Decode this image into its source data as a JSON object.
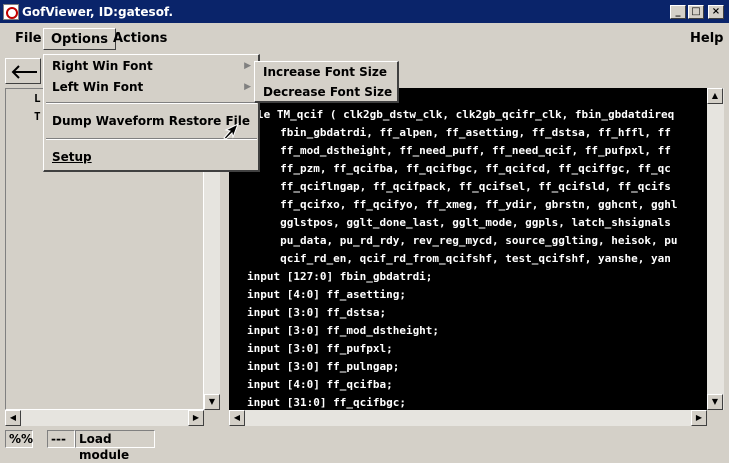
{
  "window": {
    "title": "GofViewer, ID:gatesof."
  },
  "menubar": {
    "file": "File",
    "options": "Options",
    "actions": "Actions",
    "help": "Help"
  },
  "options_menu": {
    "items": [
      {
        "label": "Right Win Font",
        "has_submenu": true
      },
      {
        "label": "Left Win Font",
        "has_submenu": true
      },
      {
        "label": "Dump Waveform Restore File",
        "has_submenu": false
      },
      {
        "label": "Setup",
        "has_submenu": false
      }
    ]
  },
  "font_submenu": {
    "items": [
      "Increase Font Size",
      "Decrease Font Size"
    ]
  },
  "left_panel": {
    "rows": [
      "L",
      "T"
    ]
  },
  "code": {
    "lines": [
      "le TM_qcif ( clk2gb_dstw_clk, clk2gb_qcifr_clk, fbin_gbdatdireq",
      "     fbin_gbdatrdi, ff_alpen, ff_asetting, ff_dstsa, ff_hffl, ff",
      "     ff_mod_dstheight, ff_need_puff, ff_need_qcif, ff_pufpxl, ff",
      "     ff_pzm, ff_qcifba, ff_qcifbgc, ff_qcifcd, ff_qciffgc, ff_qc",
      "     ff_qciflngap, ff_qcifpack, ff_qcifsel, ff_qcifsld, ff_qcifs",
      "     ff_qcifxo, ff_qcifyo, ff_xmeg, ff_ydir, gbrstn, gghcnt, gghl",
      "     gglstpos, gglt_done_last, gglt_mode, ggpls, latch_shsignals",
      "     pu_data, pu_rd_rdy, rev_reg_mycd, source_gglting, heisok, pu",
      "     qcif_rd_en, qcif_rd_from_qcifshf, test_qcifshf, yanshe, yan",
      "input [127:0] fbin_gbdatrdi;",
      "input [4:0] ff_asetting;",
      "input [3:0] ff_dstsa;",
      "input [3:0] ff_mod_dstheight;",
      "input [3:0] ff_pufpxl;",
      "input [3:0] ff_pulngap;",
      "input [4:0] ff_qcifba;",
      "input [31:0] ff_qcifbgc;"
    ]
  },
  "status": {
    "percent": "%%",
    "dashes": "---",
    "message": "Load module"
  }
}
